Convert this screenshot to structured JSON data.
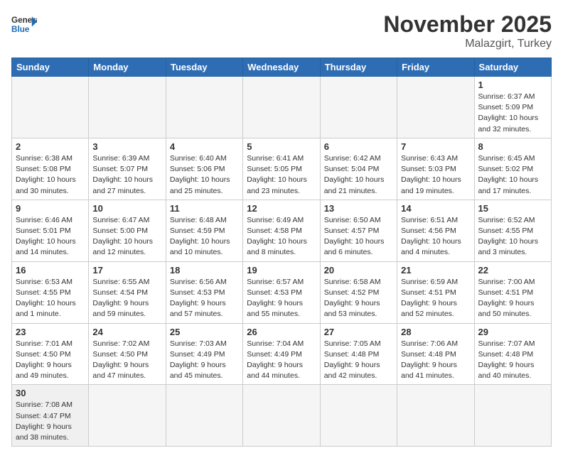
{
  "header": {
    "logo_general": "General",
    "logo_blue": "Blue",
    "month_title": "November 2025",
    "location": "Malazgirt, Turkey"
  },
  "days_of_week": [
    "Sunday",
    "Monday",
    "Tuesday",
    "Wednesday",
    "Thursday",
    "Friday",
    "Saturday"
  ],
  "weeks": [
    [
      {
        "day": "",
        "info": ""
      },
      {
        "day": "",
        "info": ""
      },
      {
        "day": "",
        "info": ""
      },
      {
        "day": "",
        "info": ""
      },
      {
        "day": "",
        "info": ""
      },
      {
        "day": "",
        "info": ""
      },
      {
        "day": "1",
        "info": "Sunrise: 6:37 AM\nSunset: 5:09 PM\nDaylight: 10 hours\nand 32 minutes."
      }
    ],
    [
      {
        "day": "2",
        "info": "Sunrise: 6:38 AM\nSunset: 5:08 PM\nDaylight: 10 hours\nand 30 minutes."
      },
      {
        "day": "3",
        "info": "Sunrise: 6:39 AM\nSunset: 5:07 PM\nDaylight: 10 hours\nand 27 minutes."
      },
      {
        "day": "4",
        "info": "Sunrise: 6:40 AM\nSunset: 5:06 PM\nDaylight: 10 hours\nand 25 minutes."
      },
      {
        "day": "5",
        "info": "Sunrise: 6:41 AM\nSunset: 5:05 PM\nDaylight: 10 hours\nand 23 minutes."
      },
      {
        "day": "6",
        "info": "Sunrise: 6:42 AM\nSunset: 5:04 PM\nDaylight: 10 hours\nand 21 minutes."
      },
      {
        "day": "7",
        "info": "Sunrise: 6:43 AM\nSunset: 5:03 PM\nDaylight: 10 hours\nand 19 minutes."
      },
      {
        "day": "8",
        "info": "Sunrise: 6:45 AM\nSunset: 5:02 PM\nDaylight: 10 hours\nand 17 minutes."
      }
    ],
    [
      {
        "day": "9",
        "info": "Sunrise: 6:46 AM\nSunset: 5:01 PM\nDaylight: 10 hours\nand 14 minutes."
      },
      {
        "day": "10",
        "info": "Sunrise: 6:47 AM\nSunset: 5:00 PM\nDaylight: 10 hours\nand 12 minutes."
      },
      {
        "day": "11",
        "info": "Sunrise: 6:48 AM\nSunset: 4:59 PM\nDaylight: 10 hours\nand 10 minutes."
      },
      {
        "day": "12",
        "info": "Sunrise: 6:49 AM\nSunset: 4:58 PM\nDaylight: 10 hours\nand 8 minutes."
      },
      {
        "day": "13",
        "info": "Sunrise: 6:50 AM\nSunset: 4:57 PM\nDaylight: 10 hours\nand 6 minutes."
      },
      {
        "day": "14",
        "info": "Sunrise: 6:51 AM\nSunset: 4:56 PM\nDaylight: 10 hours\nand 4 minutes."
      },
      {
        "day": "15",
        "info": "Sunrise: 6:52 AM\nSunset: 4:55 PM\nDaylight: 10 hours\nand 3 minutes."
      }
    ],
    [
      {
        "day": "16",
        "info": "Sunrise: 6:53 AM\nSunset: 4:55 PM\nDaylight: 10 hours\nand 1 minute."
      },
      {
        "day": "17",
        "info": "Sunrise: 6:55 AM\nSunset: 4:54 PM\nDaylight: 9 hours\nand 59 minutes."
      },
      {
        "day": "18",
        "info": "Sunrise: 6:56 AM\nSunset: 4:53 PM\nDaylight: 9 hours\nand 57 minutes."
      },
      {
        "day": "19",
        "info": "Sunrise: 6:57 AM\nSunset: 4:53 PM\nDaylight: 9 hours\nand 55 minutes."
      },
      {
        "day": "20",
        "info": "Sunrise: 6:58 AM\nSunset: 4:52 PM\nDaylight: 9 hours\nand 53 minutes."
      },
      {
        "day": "21",
        "info": "Sunrise: 6:59 AM\nSunset: 4:51 PM\nDaylight: 9 hours\nand 52 minutes."
      },
      {
        "day": "22",
        "info": "Sunrise: 7:00 AM\nSunset: 4:51 PM\nDaylight: 9 hours\nand 50 minutes."
      }
    ],
    [
      {
        "day": "23",
        "info": "Sunrise: 7:01 AM\nSunset: 4:50 PM\nDaylight: 9 hours\nand 49 minutes."
      },
      {
        "day": "24",
        "info": "Sunrise: 7:02 AM\nSunset: 4:50 PM\nDaylight: 9 hours\nand 47 minutes."
      },
      {
        "day": "25",
        "info": "Sunrise: 7:03 AM\nSunset: 4:49 PM\nDaylight: 9 hours\nand 45 minutes."
      },
      {
        "day": "26",
        "info": "Sunrise: 7:04 AM\nSunset: 4:49 PM\nDaylight: 9 hours\nand 44 minutes."
      },
      {
        "day": "27",
        "info": "Sunrise: 7:05 AM\nSunset: 4:48 PM\nDaylight: 9 hours\nand 42 minutes."
      },
      {
        "day": "28",
        "info": "Sunrise: 7:06 AM\nSunset: 4:48 PM\nDaylight: 9 hours\nand 41 minutes."
      },
      {
        "day": "29",
        "info": "Sunrise: 7:07 AM\nSunset: 4:48 PM\nDaylight: 9 hours\nand 40 minutes."
      }
    ],
    [
      {
        "day": "30",
        "info": "Sunrise: 7:08 AM\nSunset: 4:47 PM\nDaylight: 9 hours\nand 38 minutes."
      },
      {
        "day": "",
        "info": ""
      },
      {
        "day": "",
        "info": ""
      },
      {
        "day": "",
        "info": ""
      },
      {
        "day": "",
        "info": ""
      },
      {
        "day": "",
        "info": ""
      },
      {
        "day": "",
        "info": ""
      }
    ]
  ]
}
